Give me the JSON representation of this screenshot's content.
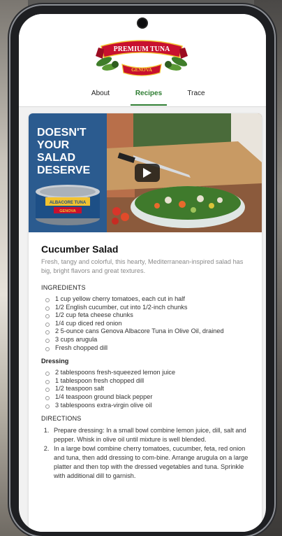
{
  "brand": {
    "logo_top": "PREMIUM TUNA",
    "logo_bottom": "GENOVA"
  },
  "tabs": [
    {
      "label": "About",
      "active": false
    },
    {
      "label": "Recipes",
      "active": true
    },
    {
      "label": "Trace",
      "active": false
    }
  ],
  "hero": {
    "headline_lines": [
      "DOESN'T",
      "YOUR",
      "SALAD",
      "DESERVE"
    ],
    "can_label_top": "ALBACORE TUNA",
    "can_label_bottom": "GENOVA",
    "media": "video-play"
  },
  "recipe": {
    "title": "Cucumber Salad",
    "description": "Fresh, tangy and colorful, this hearty, Mediterranean-inspired salad has big, bright flavors and great textures.",
    "ingredients_heading": "INGREDIENTS",
    "ingredients": [
      "1 cup yellow cherry tomatoes, each cut in half",
      "1/2 English cucumber, cut into 1/2-inch chunks",
      "1/2 cup feta cheese chunks",
      "1/4 cup diced red onion",
      "2 5-ounce cans Genova Albacore Tuna in Olive Oil, drained",
      "3 cups arugula",
      "Fresh chopped dill"
    ],
    "dressing_heading": "Dressing",
    "dressing": [
      "2 tablespoons fresh-squeezed lemon juice",
      "1 tablespoon fresh chopped dill",
      "1/2 teaspoon salt",
      "1/4 teaspoon ground black pepper",
      "3 tablespoons extra-virgin olive oil"
    ],
    "directions_heading": "DIRECTIONS",
    "directions": [
      "Prepare dressing: In a small bowl combine lemon juice, dill, salt and pepper. Whisk in olive oil until mixture is well blended.",
      "In a large bowl combine cherry tomatoes, cucumber, feta, red onion and tuna, then add dressing to com-bine. Arrange arugula on a large platter and then top with the dressed vegetables and tuna. Sprinkle with additional dill to garnish."
    ]
  },
  "colors": {
    "accent_green": "#2e7d32",
    "brand_red": "#c8102e",
    "hero_blue": "#2b5b8f"
  }
}
